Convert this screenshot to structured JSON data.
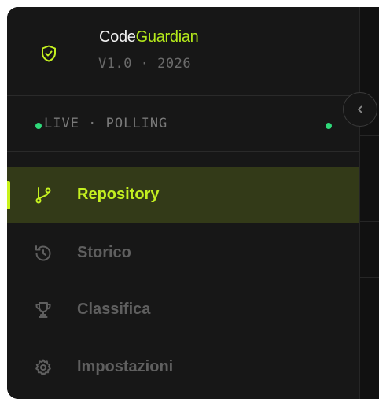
{
  "brand": {
    "name_part1": "Code",
    "name_part2": "Guardian",
    "version": "V1.0 · 2026"
  },
  "status": {
    "text": "LIVE · POLLING"
  },
  "nav": {
    "items": [
      {
        "label": "Repository",
        "icon": "git-branch-icon",
        "active": true
      },
      {
        "label": "Storico",
        "icon": "history-icon",
        "active": false
      },
      {
        "label": "Classifica",
        "icon": "trophy-icon",
        "active": false
      },
      {
        "label": "Impostazioni",
        "icon": "gear-icon",
        "active": false
      }
    ]
  },
  "colors": {
    "accent": "#c4f020",
    "live_dot": "#2fd97a",
    "sidebar_bg": "#171717",
    "active_bg": "#333a18"
  }
}
